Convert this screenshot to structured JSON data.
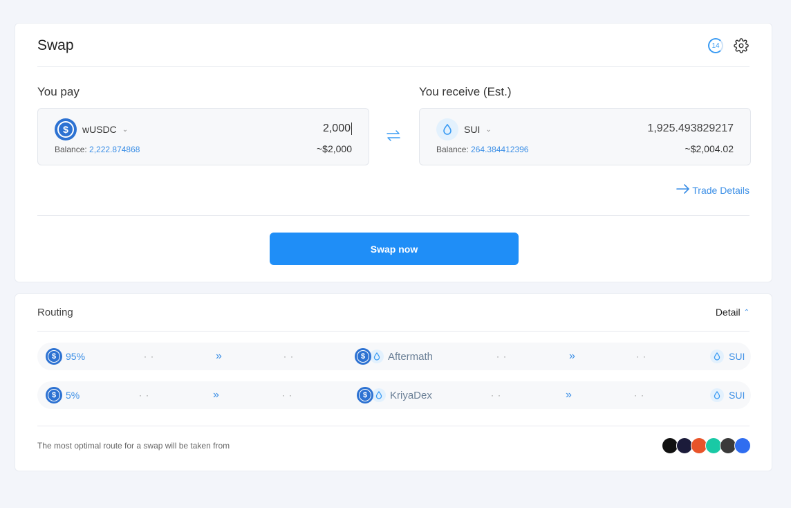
{
  "swap": {
    "title": "Swap",
    "timer_value": "14",
    "pay": {
      "label": "You pay",
      "token": "wUSDC",
      "amount": "2,000",
      "balance_label": "Balance:",
      "balance_value": "2,222.874868",
      "usd_value": "~$2,000"
    },
    "receive": {
      "label": "You receive (Est.)",
      "token": "SUI",
      "amount": "1,925.493829217",
      "balance_label": "Balance:",
      "balance_value": "264.384412396",
      "usd_value": "~$2,004.02"
    },
    "trade_details_label": "Trade Details",
    "swap_button_label": "Swap now"
  },
  "routing": {
    "title": "Routing",
    "detail_label": "Detail",
    "routes": [
      {
        "percent": "95%",
        "dex": "Aftermath",
        "to_token": "SUI"
      },
      {
        "percent": "5%",
        "dex": "KriyaDex",
        "to_token": "SUI"
      }
    ],
    "footer_text": "The most optimal route for a swap will be taken from",
    "dex_logos": [
      "#111111",
      "#1b1b3a",
      "#e8542a",
      "#19c9a5",
      "#3a3a3a",
      "#2f6df0"
    ]
  },
  "colors": {
    "accent": "#1f8ef7",
    "link": "#3a8ee6",
    "usdc": "#2d72d2",
    "background": "#f3f5fa"
  },
  "icons": {
    "timer": "refresh-timer-icon",
    "settings": "gear-icon",
    "swap_direction": "swap-arrows-icon",
    "trade_details": "arrow-right-icon"
  }
}
